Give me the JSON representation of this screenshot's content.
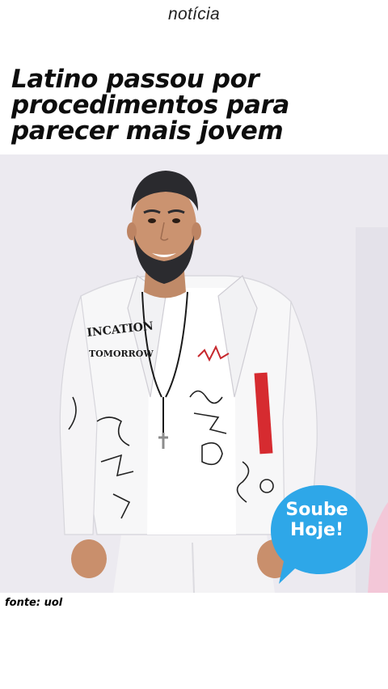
{
  "header": {
    "category": "notícia"
  },
  "article": {
    "headline": "Latino passou por procedimentos para parecer mais jovem",
    "source": "fonte: uol"
  },
  "photo": {
    "jacket_texts": [
      "INCATION",
      "TOMORROW"
    ]
  },
  "badge": {
    "line1": "Soube",
    "line2": "Hoje!",
    "color": "#2ea7e8"
  },
  "colors": {
    "background": "#ffffff",
    "photo_background": "#ecebf1",
    "text": "#0d0d0d"
  }
}
